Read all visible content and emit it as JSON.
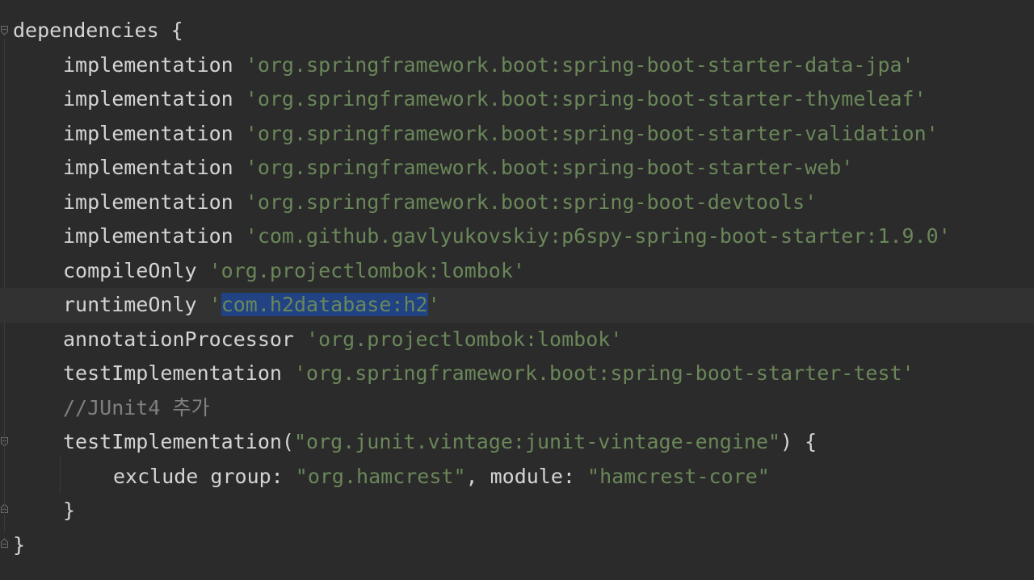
{
  "editor": {
    "lines": [
      {
        "tokens": [
          {
            "t": "dependencies {",
            "c": "plain"
          }
        ]
      },
      {
        "tokens": [
          {
            "t": "implementation ",
            "c": "plain"
          },
          {
            "t": "'org.springframework.boot:spring-boot-starter-data-jpa'",
            "c": "str"
          }
        ]
      },
      {
        "tokens": [
          {
            "t": "implementation ",
            "c": "plain"
          },
          {
            "t": "'org.springframework.boot:spring-boot-starter-thymeleaf'",
            "c": "str"
          }
        ]
      },
      {
        "tokens": [
          {
            "t": "implementation ",
            "c": "plain"
          },
          {
            "t": "'org.springframework.boot:spring-boot-starter-validation'",
            "c": "str"
          }
        ]
      },
      {
        "tokens": [
          {
            "t": "implementation ",
            "c": "plain"
          },
          {
            "t": "'org.springframework.boot:spring-boot-starter-web'",
            "c": "str"
          }
        ]
      },
      {
        "tokens": [
          {
            "t": "implementation ",
            "c": "plain"
          },
          {
            "t": "'org.springframework.boot:spring-boot-devtools'",
            "c": "str"
          }
        ]
      },
      {
        "tokens": [
          {
            "t": "implementation ",
            "c": "plain"
          },
          {
            "t": "'com.github.gavlyukovskiy:p6spy-spring-boot-starter:1.9.0'",
            "c": "str"
          }
        ]
      },
      {
        "tokens": [
          {
            "t": "compileOnly ",
            "c": "plain"
          },
          {
            "t": "'org.projectlombok:lombok'",
            "c": "str"
          }
        ]
      },
      {
        "tokens": [
          {
            "t": "runtimeOnly ",
            "c": "plain"
          },
          {
            "t": "'",
            "c": "str"
          },
          {
            "t": "com.h2database:h2",
            "c": "sel"
          },
          {
            "t": "'",
            "c": "str"
          }
        ]
      },
      {
        "tokens": [
          {
            "t": "annotationProcessor ",
            "c": "plain"
          },
          {
            "t": "'org.projectlombok:lombok'",
            "c": "str"
          }
        ]
      },
      {
        "tokens": [
          {
            "t": "testImplementation ",
            "c": "plain"
          },
          {
            "t": "'org.springframework.boot:spring-boot-starter-test'",
            "c": "str"
          }
        ]
      },
      {
        "tokens": [
          {
            "t": "//JUnit4 추가",
            "c": "cmt"
          }
        ]
      },
      {
        "tokens": [
          {
            "t": "testImplementation(",
            "c": "plain"
          },
          {
            "t": "\"org.junit.vintage:junit-vintage-engine\"",
            "c": "str"
          },
          {
            "t": ") {",
            "c": "plain"
          }
        ]
      },
      {
        "tokens": [
          {
            "t": "exclude group: ",
            "c": "plain"
          },
          {
            "t": "\"org.hamcrest\"",
            "c": "str"
          },
          {
            "t": ", module: ",
            "c": "plain"
          },
          {
            "t": "\"hamcrest-core\"",
            "c": "str"
          }
        ]
      },
      {
        "tokens": [
          {
            "t": "}",
            "c": "plain"
          }
        ]
      },
      {
        "tokens": [
          {
            "t": "}",
            "c": "plain"
          }
        ]
      }
    ]
  },
  "colors": {
    "background": "#2b2b2b",
    "current_line": "#323232",
    "selection": "#214283",
    "string": "#6a8759",
    "plain": "#d4d4d4",
    "comment": "#808080"
  }
}
